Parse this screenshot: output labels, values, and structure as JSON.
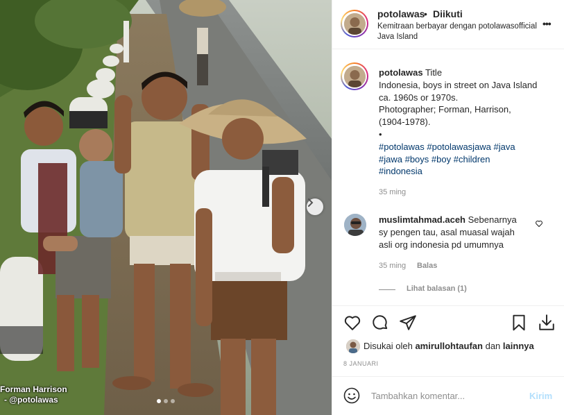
{
  "post": {
    "photo_alt": "Indonesia, boys in street on Java Island",
    "watermark_line1": "Forman Harrison",
    "watermark_line2": "- @potolawas",
    "carousel": {
      "total": 3,
      "active": 0
    }
  },
  "header": {
    "username": "potolawas",
    "separator": "•",
    "follow_status": "Diikuti",
    "subtitle": "Kemitraan berbayar dengan potolawasofficial",
    "location": "Java Island",
    "more": "•••"
  },
  "caption": {
    "username": "potolawas",
    "title": "Title",
    "line1": "Indonesia, boys in street on Java Island",
    "line2": "ca. 1960s or 1970s.",
    "line3": "Photographer; Forman, Harrison,",
    "line4": "(1904-1978).",
    "bullet": "•",
    "hashtags": [
      "#potolawas",
      "#potolawasjawa",
      "#java",
      "#jawa",
      "#boys",
      "#boy",
      "#children",
      "#indonesia"
    ],
    "time": "35 ming"
  },
  "comment": {
    "username": "muslimtahmad.aceh",
    "text": "Sebenarnya sy pengen tau, asal muasal wajah asli org indonesia pd umumnya",
    "time": "35 ming",
    "reply_label": "Balas",
    "view_replies": "Lihat balasan (1)"
  },
  "actions": {
    "icons": [
      "heart-icon",
      "comment-icon",
      "share-icon",
      "bookmark-icon",
      "download-icon"
    ],
    "liked_prefix": "Disukai oleh",
    "liked_user": "amirullohtaufan",
    "liked_and": "dan",
    "liked_others": "lainnya",
    "date": "8 JANUARI"
  },
  "composer": {
    "placeholder": "Tambahkan komentar...",
    "send_label": "Kirim"
  },
  "colors": {
    "hashtag": "#00376b",
    "muted": "#8e8e8e",
    "send_disabled": "#b2dffc"
  }
}
